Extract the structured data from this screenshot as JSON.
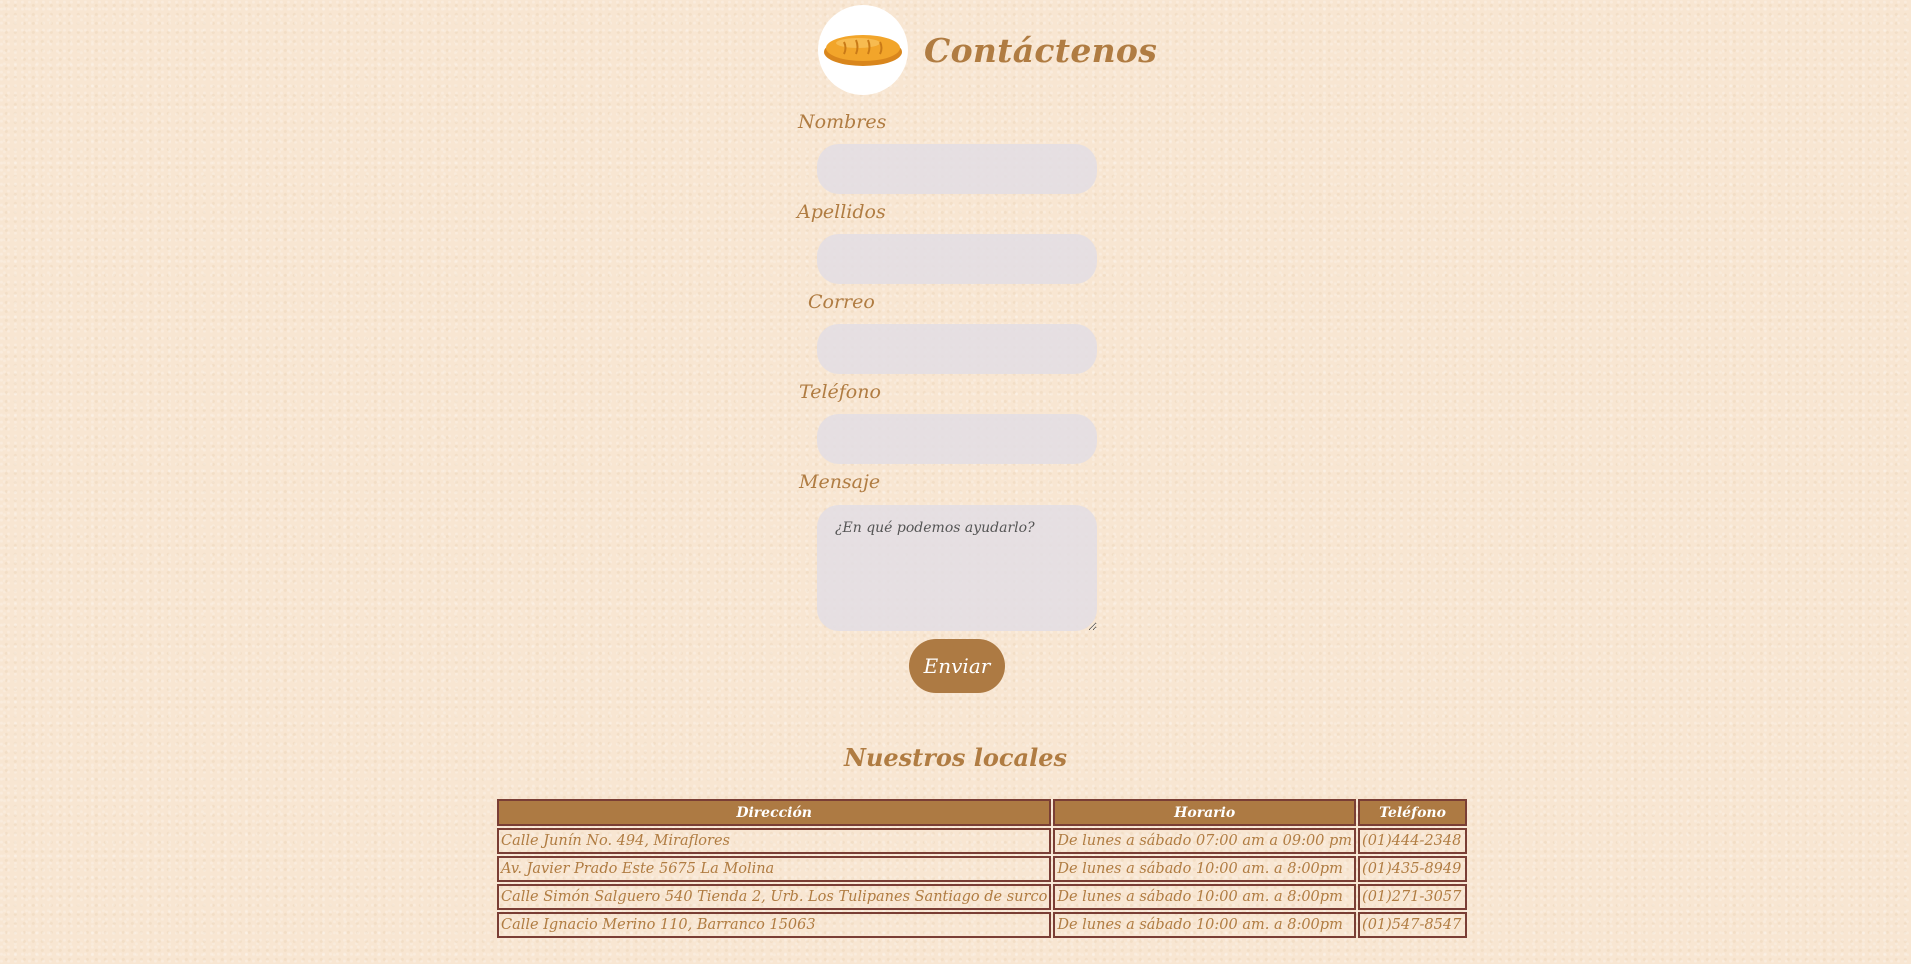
{
  "header": {
    "title": "Contáctenos",
    "logo_icon": "bread-icon"
  },
  "form": {
    "nombres_label": "Nombres",
    "nombres_value": "",
    "apellidos_label": "Apellidos",
    "apellidos_value": "",
    "correo_label": "Correo",
    "correo_value": "",
    "telefono_label": "Teléfono",
    "telefono_value": "",
    "mensaje_label": "Mensaje",
    "mensaje_placeholder": "¿En qué podemos ayudarlo?",
    "submit_label": "Enviar"
  },
  "locales": {
    "title": "Nuestros locales",
    "columns": [
      "Dirección",
      "Horario",
      "Teléfono"
    ],
    "rows": [
      [
        "Calle Junín No. 494, Miraflores",
        "De lunes a sábado 07:00 am a 09:00 pm",
        "(01)444-2348"
      ],
      [
        "Av. Javier Prado Este 5675 La Molina",
        "De lunes a sábado 10:00 am. a 8:00pm",
        "(01)435-8949"
      ],
      [
        "Calle Simón Salguero 540 Tienda 2, Urb. Los Tulipanes Santiago de surco",
        "De lunes a sábado 10:00 am. a 8:00pm",
        "(01)271-3057"
      ],
      [
        "Calle Ignacio Merino 110, Barranco 15063",
        "De lunes a sábado 10:00 am. a 8:00pm",
        "(01)547-8547"
      ]
    ]
  },
  "colors": {
    "background": "#f8e6d2",
    "accent": "#ad7a43",
    "text": "#b07c42",
    "border": "#7a3e35",
    "field_bg": "#e2dee4"
  }
}
